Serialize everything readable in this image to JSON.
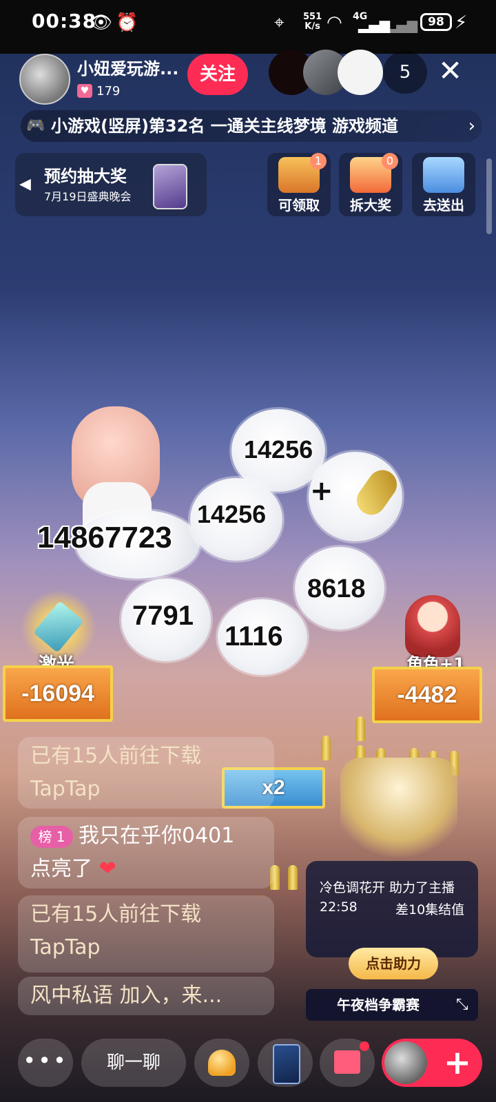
{
  "status_bar": {
    "time": "00:38",
    "net_speed_value": "551",
    "net_speed_unit": "K/s",
    "network": "4G",
    "battery": "98"
  },
  "header": {
    "streamer_name": "小妞爱玩游...",
    "likes_count": "179",
    "follow_label": "关注",
    "viewer_count": "5",
    "close_icon": "close-icon"
  },
  "rank_bar": {
    "text": "小游戏(竖屏)第32名 一通关主线梦境   游戏频道",
    "chevron": "chevron-right-icon"
  },
  "lottery": {
    "title": "预约抽大奖",
    "subtitle": "7月19日盛典晚会"
  },
  "rewards": [
    {
      "label": "可领取",
      "badge": "1",
      "icon": "treasure-chest-icon",
      "color": "#f3a93b"
    },
    {
      "label": "拆大奖",
      "badge": "0",
      "icon": "gift-box-icon",
      "color": "#f58a4a"
    },
    {
      "label": "去送出",
      "badge": "",
      "icon": "popularity-ticket-icon",
      "color": "#6fb3f0"
    }
  ],
  "game": {
    "boss_score": "14867723",
    "cloud_numbers": [
      "14256",
      "14256",
      "8618",
      "7791",
      "1116"
    ],
    "laser_label": "激光",
    "laser_value": "-16094",
    "character_label": "角色+1",
    "character_value": "-4482",
    "multiplier": "x2"
  },
  "chat": {
    "msg1": "已有15人前往下载TapTap",
    "rank_badge": "榜 1",
    "msg2_user": "我只在乎你0401",
    "msg2_text": "点亮了",
    "heart": "❤",
    "msg3": "已有15人前往下载TapTap",
    "msg4": "风中私语 加入，来..."
  },
  "support": {
    "line1": "冷色调花开 助力了主播",
    "time": "22:58",
    "gap": "差10集结值",
    "button": "点击助力",
    "contest": "午夜档争霸赛"
  },
  "bottom_bar": {
    "more": "•••",
    "chat_label": "聊一聊",
    "plus": "+"
  }
}
